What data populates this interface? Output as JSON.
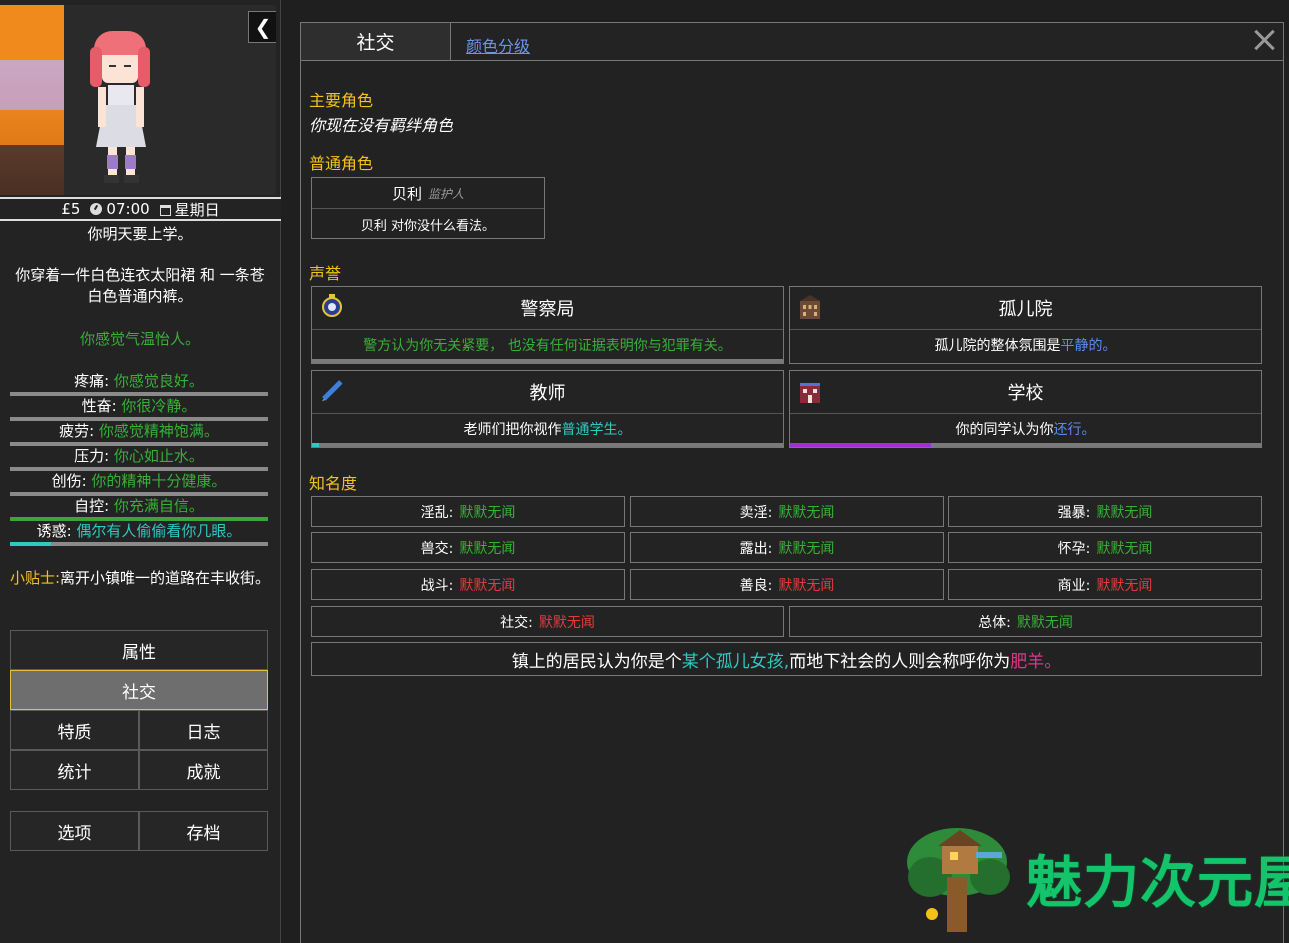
{
  "sidebar": {
    "status": {
      "money": "£5",
      "time": "07:00",
      "day": "星期日"
    },
    "notice": "你明天要上学。",
    "clothing": "你穿着一件白色连衣太阳裙 和 一条苍白色普通内裤。",
    "mood": "你感觉气温怡人。",
    "stats": [
      {
        "label": "疼痛:",
        "value": "你感觉良好。",
        "value_color": "#38b038",
        "fill_level": 0,
        "fill_color": "#38b038"
      },
      {
        "label": "性奋:",
        "value": "你很冷静。",
        "value_color": "#38b038",
        "fill_level": 0,
        "fill_color": "#38b038"
      },
      {
        "label": "疲劳:",
        "value": "你感觉精神饱满。",
        "value_color": "#38b038",
        "fill_level": 0,
        "fill_color": "#38b038"
      },
      {
        "label": "压力:",
        "value": "你心如止水。",
        "value_color": "#38b038",
        "fill_level": 0,
        "fill_color": "#38b038"
      },
      {
        "label": "创伤:",
        "value": "你的精神十分健康。",
        "value_color": "#38b038",
        "fill_level": 0,
        "fill_color": "#38b038"
      },
      {
        "label": "自控:",
        "value": "你充满自信。",
        "value_color": "#38b038",
        "fill_level": 1,
        "fill_color": "#3aa53a"
      },
      {
        "label": "诱惑:",
        "value": "偶尔有人偷偷看你几眼。",
        "value_color": "#2ec9c2",
        "fill_level": 0.16,
        "fill_color": "#2ec9c2"
      }
    ],
    "tip_label": "小贴士:",
    "tip_text": "离开小镇唯一的道路在丰收街。",
    "nav": {
      "attributes": "属性",
      "social": "社交",
      "traits": "特质",
      "journal": "日志",
      "stats": "统计",
      "achievements": "成就",
      "options": "选项",
      "saves": "存档"
    }
  },
  "panel": {
    "tab_active": "社交",
    "tab_link": "颜色分级",
    "main_chars_title": "主要角色",
    "main_chars_note": "你现在没有羁绊角色",
    "common_chars_title": "普通角色",
    "npc": {
      "name": "贝利",
      "role": "监护人",
      "desc": "贝利 对你没什么看法。"
    },
    "reputation_title": "声誉",
    "reputation": [
      {
        "name": "警察局",
        "icon": "police-badge-icon",
        "desc": "警方认为你无关紧要， 也没有任何证据表明你与犯罪有关。",
        "desc_color": "#38b038",
        "highlight": "",
        "fill_level": 0,
        "fill_color": "#38b038"
      },
      {
        "name": "孤儿院",
        "icon": "orphanage-building-icon",
        "desc": "孤儿院的整体氛围是 ",
        "desc_color": "#ffffff",
        "highlight": "平静的。",
        "highlight_color": "#5b8cf0",
        "fill_level": 0,
        "fill_color": "#5b8cf0"
      },
      {
        "name": "教师",
        "icon": "pencil-icon",
        "desc": "老师们把你视作 ",
        "desc_color": "#ffffff",
        "highlight": "普通学生。",
        "highlight_color": "#2ec9c2",
        "fill_level": 0.015,
        "fill_color": "#2ec9c2"
      },
      {
        "name": "学校",
        "icon": "school-building-icon",
        "desc": "你的同学认为你 ",
        "desc_color": "#ffffff",
        "highlight": "还行。",
        "highlight_color": "#5b8cf0",
        "fill_level": 0.3,
        "fill_color": "#a12fd6"
      }
    ],
    "fame_title": "知名度",
    "fame": [
      {
        "label": "淫乱:",
        "value": "默默无闻",
        "color": "#38b038"
      },
      {
        "label": "卖淫:",
        "value": "默默无闻",
        "color": "#38b038"
      },
      {
        "label": "强暴:",
        "value": "默默无闻",
        "color": "#38b038"
      },
      {
        "label": "兽交:",
        "value": "默默无闻",
        "color": "#38b038"
      },
      {
        "label": "露出:",
        "value": "默默无闻",
        "color": "#38b038"
      },
      {
        "label": "怀孕:",
        "value": "默默无闻",
        "color": "#38b038"
      },
      {
        "label": "战斗:",
        "value": "默默无闻",
        "color": "#e23b3b"
      },
      {
        "label": "善良:",
        "value": "默默无闻",
        "color": "#e23b3b"
      },
      {
        "label": "商业:",
        "value": "默默无闻",
        "color": "#e23b3b"
      }
    ],
    "fame_wide": [
      {
        "label": "社交:",
        "value": "默默无闻",
        "color": "#e23b3b"
      },
      {
        "label": "总体:",
        "value": "默默无闻",
        "color": "#38b038"
      }
    ],
    "summary": {
      "part1": "镇上的居民认为你是个",
      "highlight1": "某个孤儿女孩,",
      "part2": "而地下社会的人则会称呼你为",
      "highlight2": "肥羊。"
    }
  },
  "watermark": {
    "text": "魅力次元屋"
  }
}
